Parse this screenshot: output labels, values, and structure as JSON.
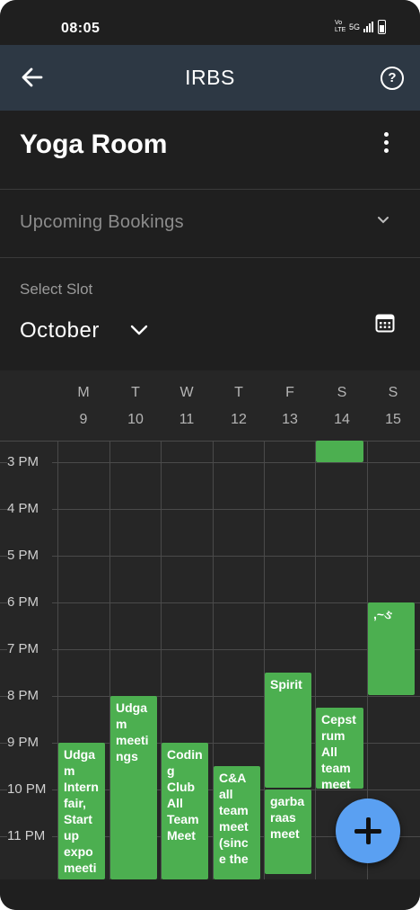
{
  "status_bar": {
    "time": "08:05",
    "network_label": "Vo LTE",
    "signal_label": "5G"
  },
  "app_bar": {
    "title": "IRBS",
    "back_icon": "arrow-left-icon",
    "help_icon": "question-circle-icon"
  },
  "room": {
    "name": "Yoga Room",
    "menu_icon": "more-vertical-icon"
  },
  "upcoming": {
    "label": "Upcoming Bookings",
    "icon": "chevron-down-icon"
  },
  "slot": {
    "label": "Select Slot",
    "month": "October",
    "calendar_icon": "calendar-icon"
  },
  "days": [
    {
      "letter": "M",
      "num": "9"
    },
    {
      "letter": "T",
      "num": "10"
    },
    {
      "letter": "W",
      "num": "11"
    },
    {
      "letter": "T",
      "num": "12"
    },
    {
      "letter": "F",
      "num": "13"
    },
    {
      "letter": "S",
      "num": "14"
    },
    {
      "letter": "S",
      "num": "15"
    }
  ],
  "hours": [
    "3 PM",
    "4 PM",
    "5 PM",
    "6 PM",
    "7 PM",
    "8 PM",
    "9 PM",
    "10 PM",
    "11 PM"
  ],
  "events": [
    {
      "text": "Udgam Internfair, Startup expo meeting"
    },
    {
      "text": "Udgam meetings"
    },
    {
      "text": "Coding Club All Team Meet"
    },
    {
      "text": "C&A all team meet (since the"
    },
    {
      "text": "Spirit"
    },
    {
      "text": "garbaraas meet"
    },
    {
      "text": ""
    },
    {
      "text": "Cepstrum All team meet"
    },
    {
      "text": ",~ઙ"
    }
  ],
  "fab": {
    "icon": "plus-icon"
  },
  "colors": {
    "event_green": "#4caf50",
    "app_bar": "#2d3844",
    "background": "#1f1f1f",
    "fab_blue": "#5aa0f2"
  }
}
